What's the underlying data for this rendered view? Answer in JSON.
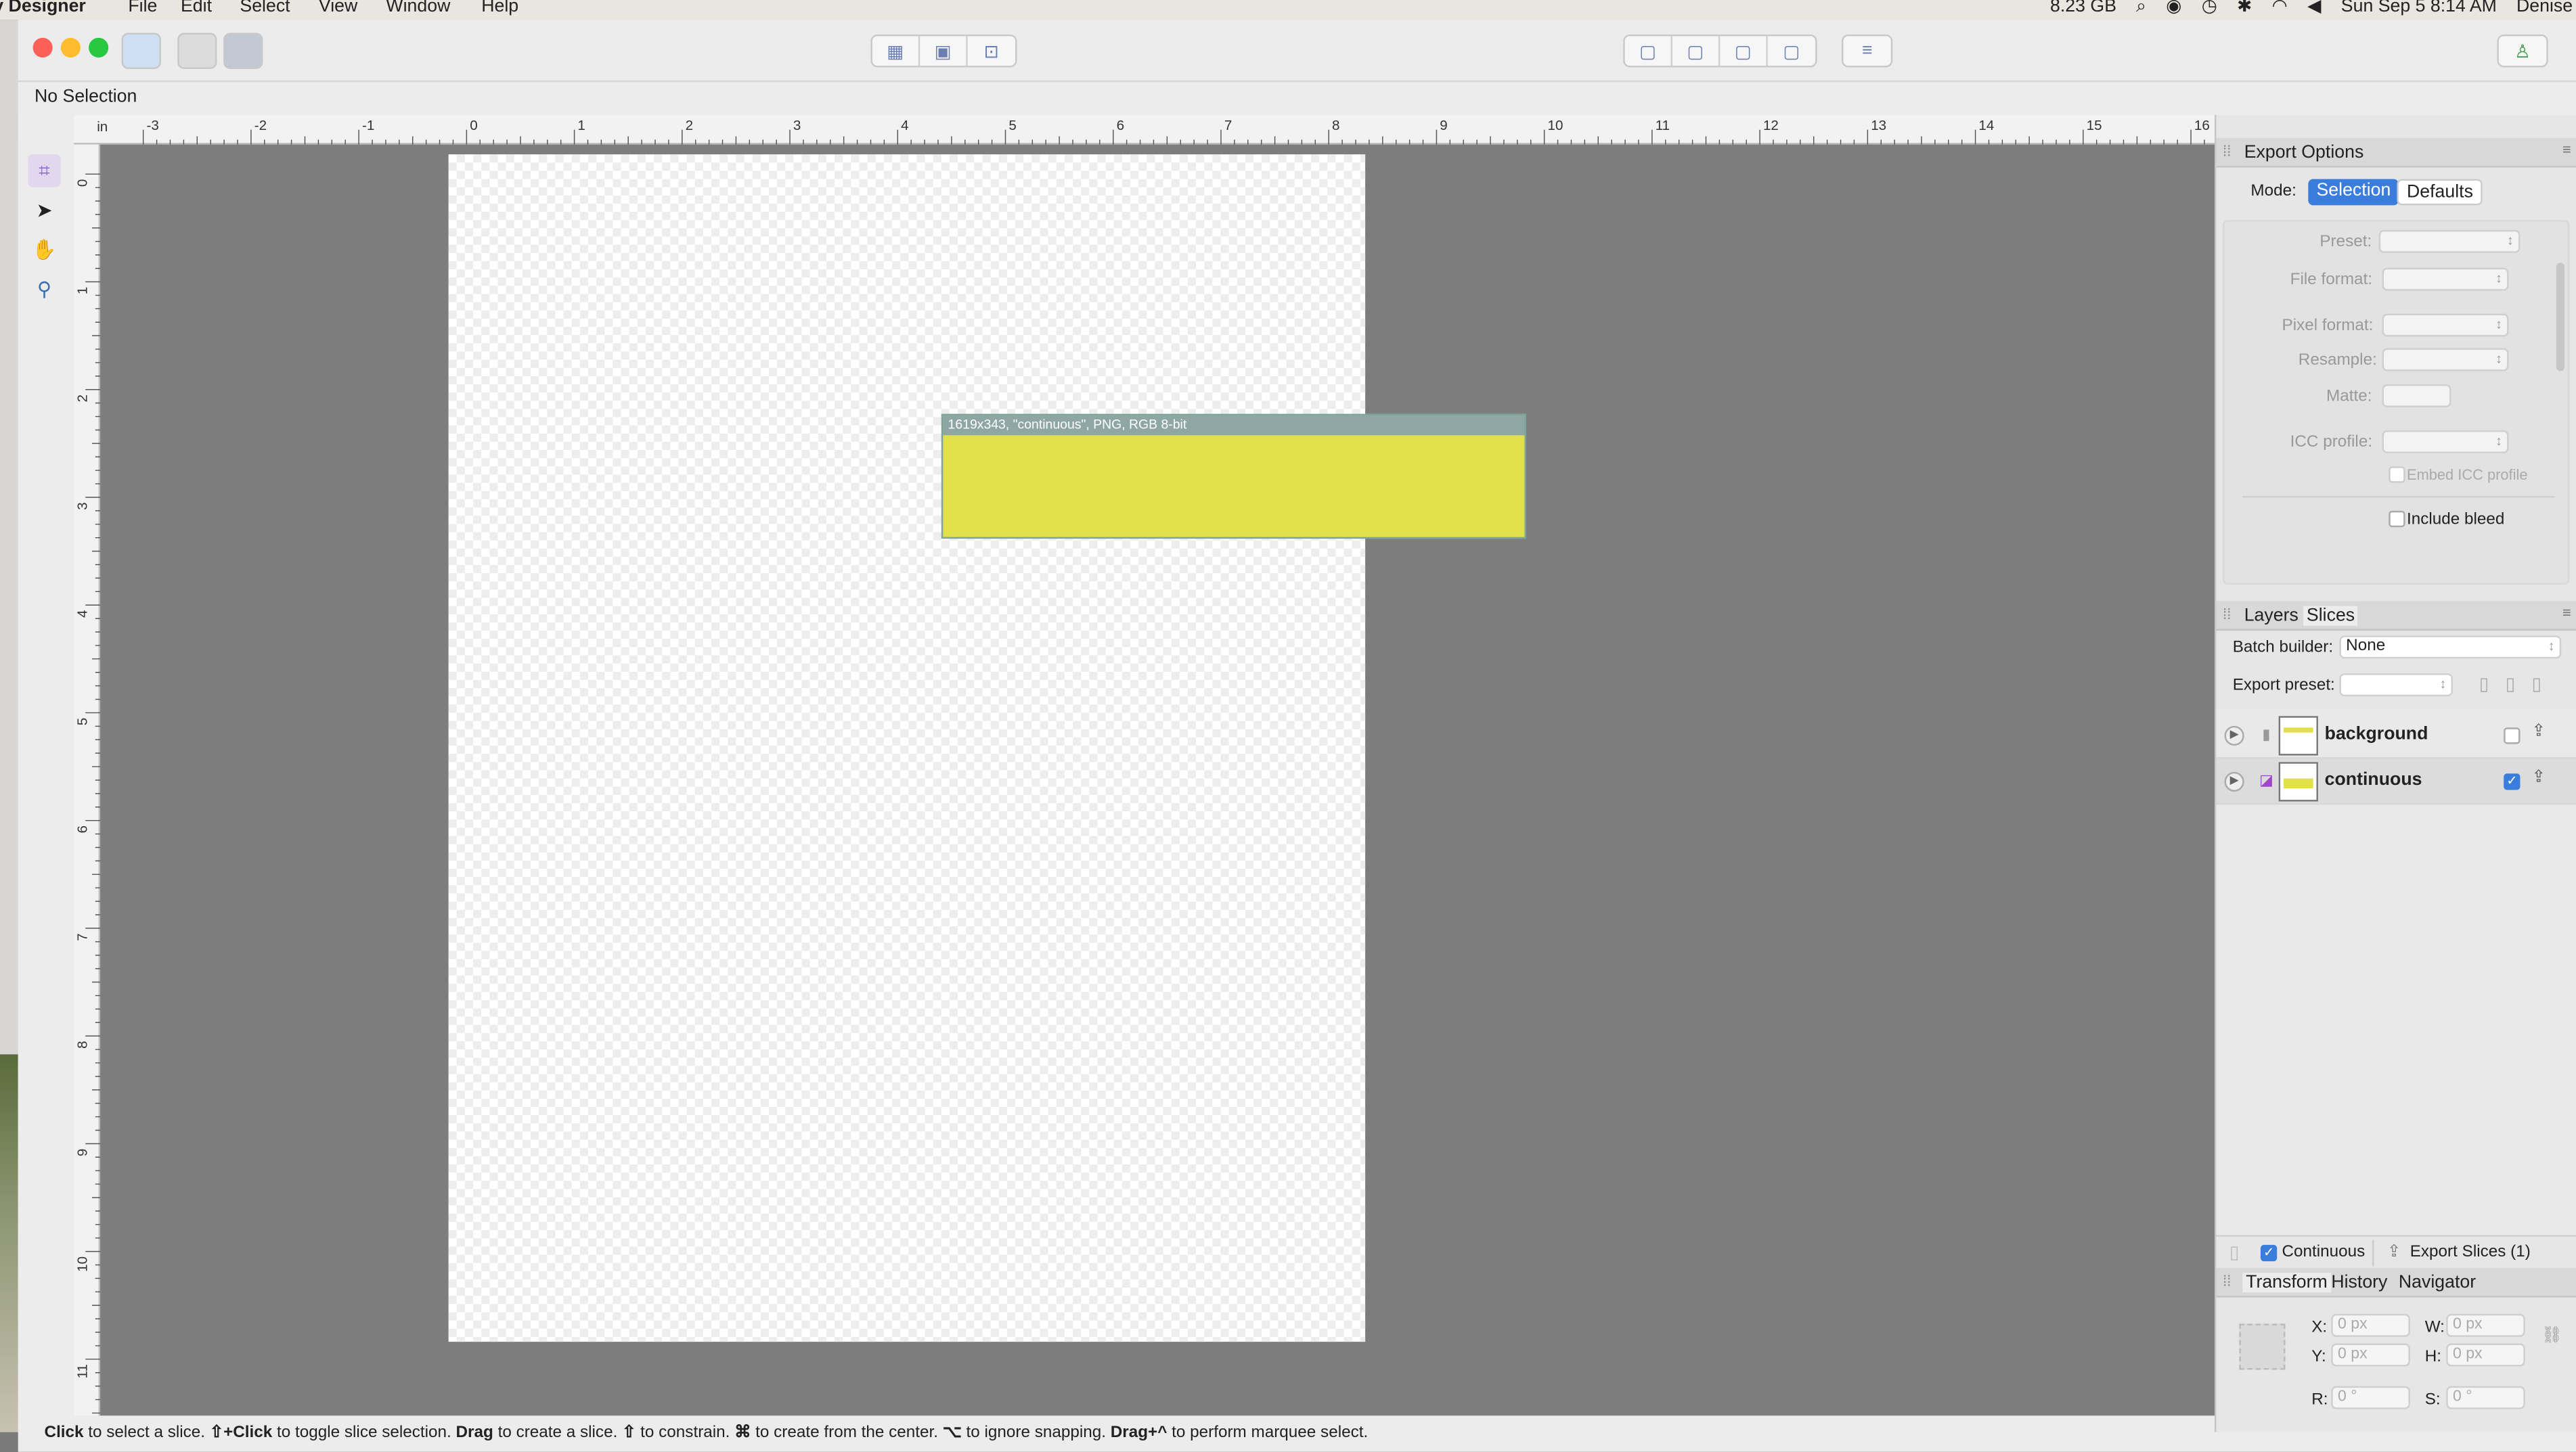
{
  "menubar": {
    "app_name": "y Designer",
    "menus": [
      "File",
      "Edit",
      "Select",
      "View",
      "Window",
      "Help"
    ],
    "memory": "8.23 GB",
    "datetime": "Sun Sep 5  8:14 AM",
    "user": "Denise"
  },
  "context": {
    "selection_status": "No Selection"
  },
  "ruler": {
    "unit": "in",
    "top_ticks": [
      "-3",
      "-2",
      "-1",
      "0",
      "1",
      "2",
      "3",
      "4",
      "5",
      "6",
      "7",
      "8",
      "9",
      "10",
      "11",
      "12",
      "13",
      "14",
      "15",
      "16"
    ],
    "left_ticks": [
      "0",
      "1",
      "2",
      "3",
      "4",
      "5",
      "6",
      "7",
      "8",
      "9",
      "10",
      "11"
    ]
  },
  "slice": {
    "label": "1619x343, \"continuous\", PNG, RGB 8-bit",
    "color": "#e1df4c"
  },
  "export_options": {
    "title": "Export Options",
    "mode_label": "Mode:",
    "mode_selection": "Selection",
    "mode_defaults": "Defaults",
    "preset_label": "Preset:",
    "file_format_label": "File format:",
    "pixel_format_label": "Pixel format:",
    "resample_label": "Resample:",
    "matte_label": "Matte:",
    "icc_profile_label": "ICC profile:",
    "embed_icc_label": "Embed ICC profile",
    "include_bleed_label": "Include bleed"
  },
  "slices_panel": {
    "tab_layers": "Layers",
    "tab_slices": "Slices",
    "batch_builder_label": "Batch builder:",
    "batch_builder_value": "None",
    "export_preset_label": "Export preset:",
    "items": [
      {
        "name": "background",
        "checked": false
      },
      {
        "name": "continuous",
        "checked": true
      }
    ],
    "continuous_label": "Continuous",
    "export_slices_label": "Export Slices (1)"
  },
  "transform_panel": {
    "tab_transform": "Transform",
    "tab_history": "History",
    "tab_navigator": "Navigator",
    "x_label": "X:",
    "y_label": "Y:",
    "w_label": "W:",
    "h_label": "H:",
    "r_label": "R:",
    "s_label": "S:",
    "x_value": "0 px",
    "y_value": "0 px",
    "w_value": "0 px",
    "h_value": "0 px",
    "r_value": "0 °",
    "s_value": "0 °"
  },
  "status": {
    "hint_html": "<b>Click</b> to select a slice. <b>⇧+Click</b> to toggle slice selection. <b>Drag</b> to create a slice. <b>⇧</b> to constrain. <b>⌘</b> to create from the center. <b>⌥</b> to ignore snapping. <b>Drag+^</b> to perform marquee select."
  },
  "colors": {
    "accent": "#3b7ddd",
    "slice_fill": "#e1df4c",
    "canvas_bg": "#7d7d7d"
  }
}
